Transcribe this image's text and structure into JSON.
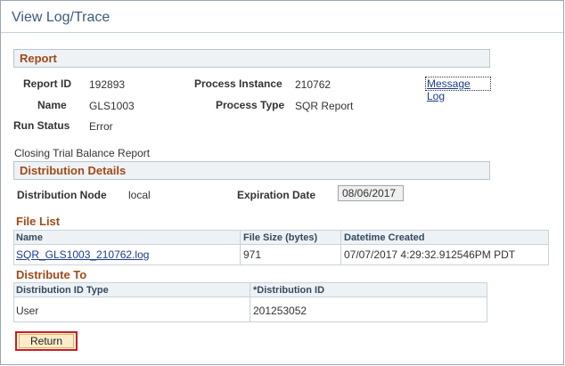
{
  "page": {
    "title": "View Log/Trace"
  },
  "report": {
    "header": "Report",
    "report_id_label": "Report ID",
    "report_id": "192893",
    "process_instance_label": "Process Instance",
    "process_instance": "210762",
    "message_log": "Message Log",
    "name_label": "Name",
    "name": "GLS1003",
    "process_type_label": "Process Type",
    "process_type": "SQR Report",
    "run_status_label": "Run Status",
    "run_status": "Error",
    "description": "Closing Trial Balance Report"
  },
  "distribution": {
    "header": "Distribution Details",
    "node_label": "Distribution Node",
    "node": "local",
    "expiration_label": "Expiration Date",
    "expiration": "08/06/2017"
  },
  "file_list": {
    "title": "File List",
    "columns": [
      "Name",
      "File Size (bytes)",
      "Datetime Created"
    ],
    "rows": [
      {
        "name": "SQR_GLS1003_210762.log",
        "size": "971",
        "created": "07/07/2017  4:29:32.912546PM PDT"
      }
    ]
  },
  "distribute_to": {
    "title": "Distribute To",
    "columns": [
      "Distribution ID Type",
      "*Distribution ID"
    ],
    "rows": [
      {
        "type": "User",
        "id": "201253052"
      }
    ]
  },
  "buttons": {
    "return_label": "Return"
  },
  "colors": {
    "section_title": "#a14a18",
    "link": "#1b3c8a",
    "button_border": "#c81e2a"
  }
}
